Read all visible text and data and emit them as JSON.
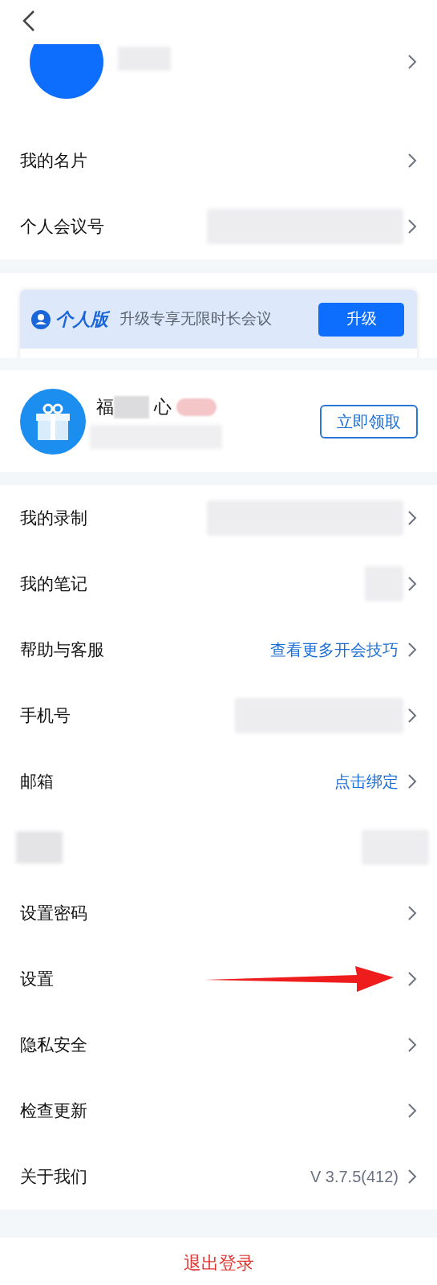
{
  "profile": {
    "name_redacted": true,
    "chevron": true
  },
  "top_rows": [
    {
      "label": "我的名片",
      "chevron": true
    },
    {
      "label": "个人会议号",
      "value_redacted": true,
      "chevron": true
    }
  ],
  "banner": {
    "plan": "个人版",
    "text": "升级专享无限时长会议",
    "button": "升级"
  },
  "gift": {
    "title_start": "福",
    "title_end": "心",
    "name_redacted": true,
    "tag_redacted": true,
    "subtitle_redacted": true,
    "button": "立即领取"
  },
  "rows": [
    {
      "label": "我的录制",
      "value_redacted": true,
      "chevron": true
    },
    {
      "label": "我的笔记",
      "value_redacted": true,
      "chevron": true
    },
    {
      "label": "帮助与客服",
      "value": "查看更多开会技巧",
      "kind": "link",
      "chevron": true
    },
    {
      "label": "手机号",
      "value_redacted": true,
      "chevron": true
    },
    {
      "label": "邮箱",
      "value": "点击绑定",
      "kind": "link",
      "chevron": true
    },
    {
      "label_redacted": true,
      "value_redacted": true,
      "chevron": false
    },
    {
      "label": "设置密码",
      "chevron": true
    },
    {
      "label": "设置",
      "chevron": true,
      "arrow": true
    },
    {
      "label": "隐私安全",
      "chevron": true
    },
    {
      "label": "检查更新",
      "chevron": true
    },
    {
      "label": "关于我们",
      "value": "V 3.7.5(412)",
      "kind": "muted",
      "chevron": true
    }
  ],
  "logout": "退出登录"
}
